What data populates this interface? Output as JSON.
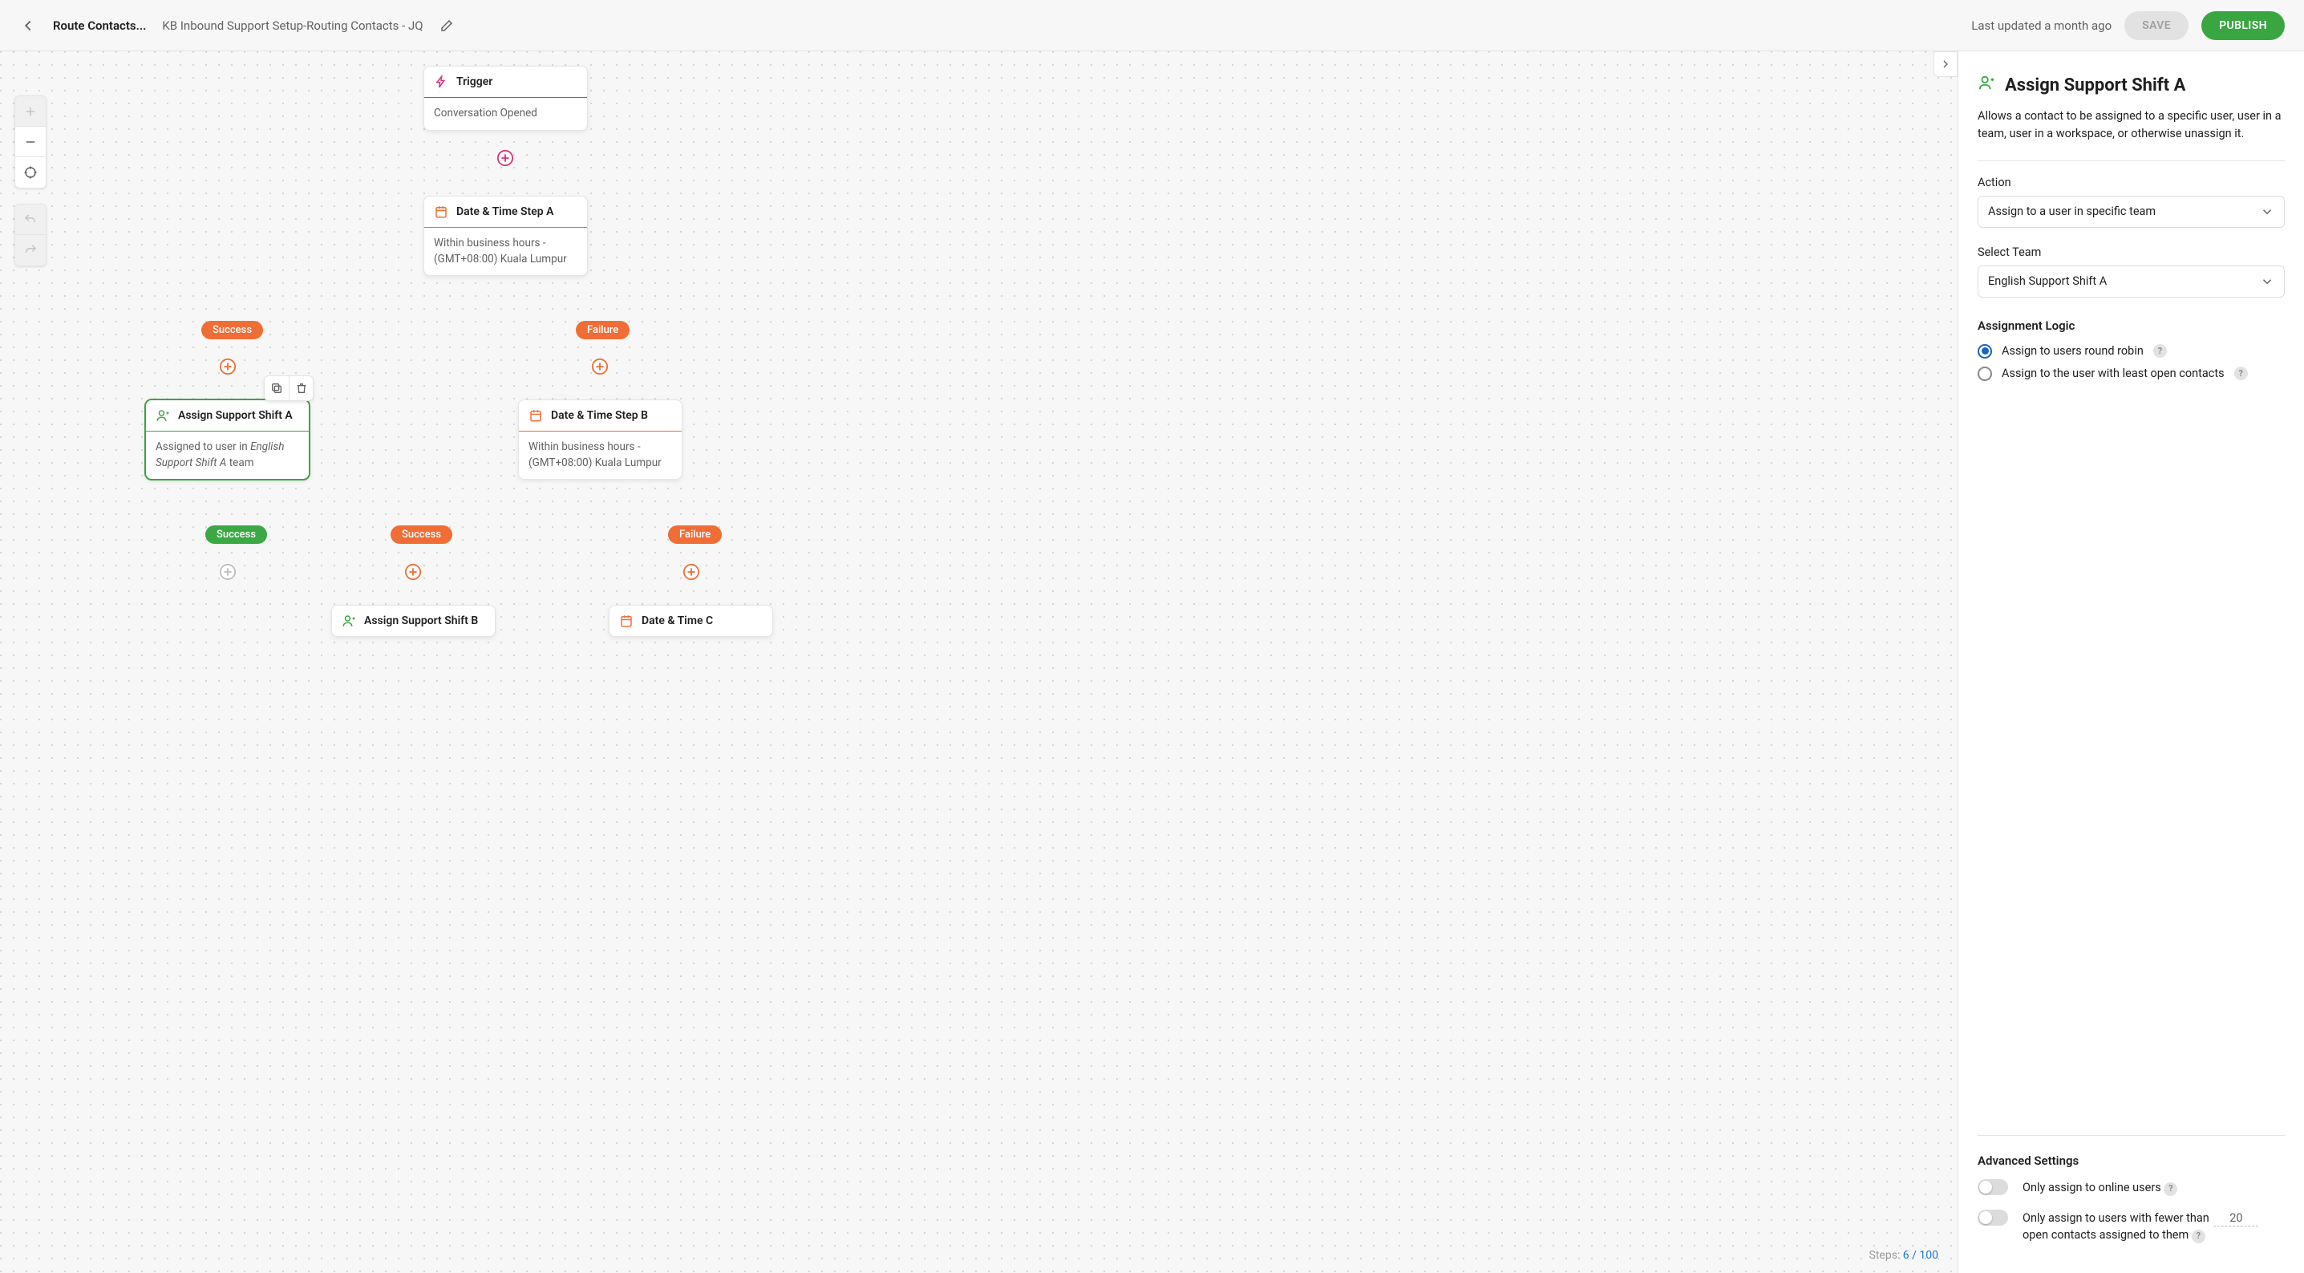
{
  "header": {
    "title_truncated": "Route Contacts...",
    "breadcrumb": "KB Inbound Support Setup-Routing Contacts - JQ",
    "last_updated": "Last updated a month ago",
    "save_label": "SAVE",
    "publish_label": "PUBLISH"
  },
  "canvas": {
    "nodes": {
      "trigger": {
        "title": "Trigger",
        "body": "Conversation Opened"
      },
      "dtA": {
        "title": "Date & Time Step A",
        "body": "Within business hours - (GMT+08:00) Kuala Lumpur"
      },
      "assignA": {
        "title": "Assign Support Shift A",
        "body_prefix": "Assigned to user in ",
        "body_team": "English Support Shift A",
        "body_suffix": " team"
      },
      "dtB": {
        "title": "Date & Time Step B",
        "body": "Within business hours - (GMT+08:00) Kuala Lumpur"
      },
      "assignB": {
        "title": "Assign Support Shift B"
      },
      "dtC": {
        "title": "Date & Time C"
      }
    },
    "pills": {
      "success": "Success",
      "failure": "Failure"
    },
    "steps_indicator": {
      "label": "Steps: ",
      "value": "6 / 100"
    }
  },
  "panel": {
    "title": "Assign Support Shift A",
    "description": "Allows a contact to be assigned to a specific user, user in a team, user in a workspace, or otherwise unassign it.",
    "action_label": "Action",
    "action_value": "Assign to a user in specific team",
    "team_label": "Select Team",
    "team_value": "English Support Shift A",
    "logic_label": "Assignment Logic",
    "logic_options": {
      "round_robin": "Assign to users round robin",
      "least_open": "Assign to the user with least open contacts"
    },
    "advanced_label": "Advanced Settings",
    "adv_online": "Only assign to online users",
    "adv_fewer_prefix": "Only assign to users with fewer than",
    "adv_fewer_value": "20",
    "adv_fewer_suffix": "open contacts assigned to them"
  },
  "colors": {
    "green": "#3aa641",
    "orange": "#f06d36",
    "magenta": "#d83379"
  }
}
